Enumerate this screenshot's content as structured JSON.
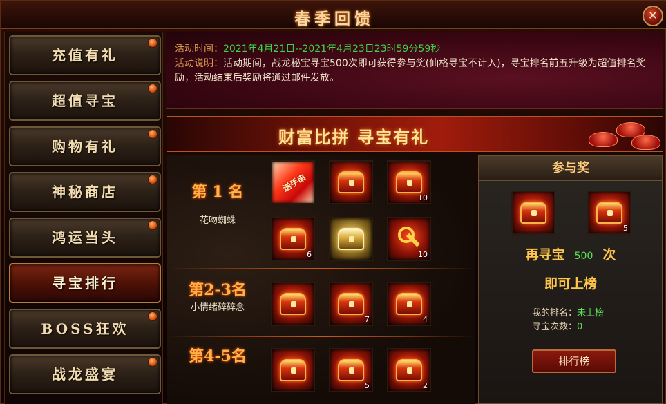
{
  "window": {
    "title": "春季回馈",
    "close_icon": "close-icon"
  },
  "sidebar": {
    "items": [
      {
        "label": "充值有礼",
        "active": false
      },
      {
        "label": "超值寻宝",
        "active": false
      },
      {
        "label": "购物有礼",
        "active": false
      },
      {
        "label": "神秘商店",
        "active": false
      },
      {
        "label": "鸿运当头",
        "active": false
      },
      {
        "label": "寻宝排行",
        "active": true
      },
      {
        "label": "BOSS狂欢",
        "active": false
      },
      {
        "label": "战龙盛宴",
        "active": false
      }
    ]
  },
  "info": {
    "time_label": "活动时间：",
    "time_value": "2021年4月21日--2021年4月23日23时59分59秒",
    "desc_label": "活动说明：",
    "desc_value": "活动期间，战龙秘宝寻宝500次即可获得参与奖(仙格寻宝不计入)，寻宝排名前五升级为超值排名奖励，活动结束后奖励将通过邮件发放。"
  },
  "banner": {
    "text": "财富比拼  寻宝有礼"
  },
  "ranks": [
    {
      "title": "第 1 名",
      "name": "花吻蜘蛛",
      "items": [
        {
          "type": "red-scroll",
          "count": "",
          "label": "送手串"
        },
        {
          "type": "chest",
          "count": ""
        },
        {
          "type": "chest",
          "count": "10"
        },
        {
          "type": "chest",
          "count": "6"
        },
        {
          "type": "gold",
          "count": ""
        },
        {
          "type": "key",
          "count": "10"
        }
      ]
    },
    {
      "title": "第2-3名",
      "name": "小情绪碎碎念",
      "items": [
        {
          "type": "chest",
          "count": ""
        },
        {
          "type": "chest",
          "count": "7"
        },
        {
          "type": "chest",
          "count": "4"
        }
      ]
    },
    {
      "title": "第4-5名",
      "name": "",
      "items": [
        {
          "type": "chest",
          "count": ""
        },
        {
          "type": "chest",
          "count": "5"
        },
        {
          "type": "chest",
          "count": "2"
        }
      ]
    }
  ],
  "participate": {
    "header": "参与奖",
    "items": [
      {
        "type": "chest",
        "count": ""
      },
      {
        "type": "chest",
        "count": "5"
      }
    ],
    "line1_prefix": "再寻宝",
    "line1_num": "500",
    "line1_suffix": "次",
    "line2": "即可上榜",
    "my_rank_label": "我的排名：",
    "my_rank_value": "未上榜",
    "count_label": "寻宝次数：",
    "count_value": "0",
    "button_label": "排行榜"
  }
}
